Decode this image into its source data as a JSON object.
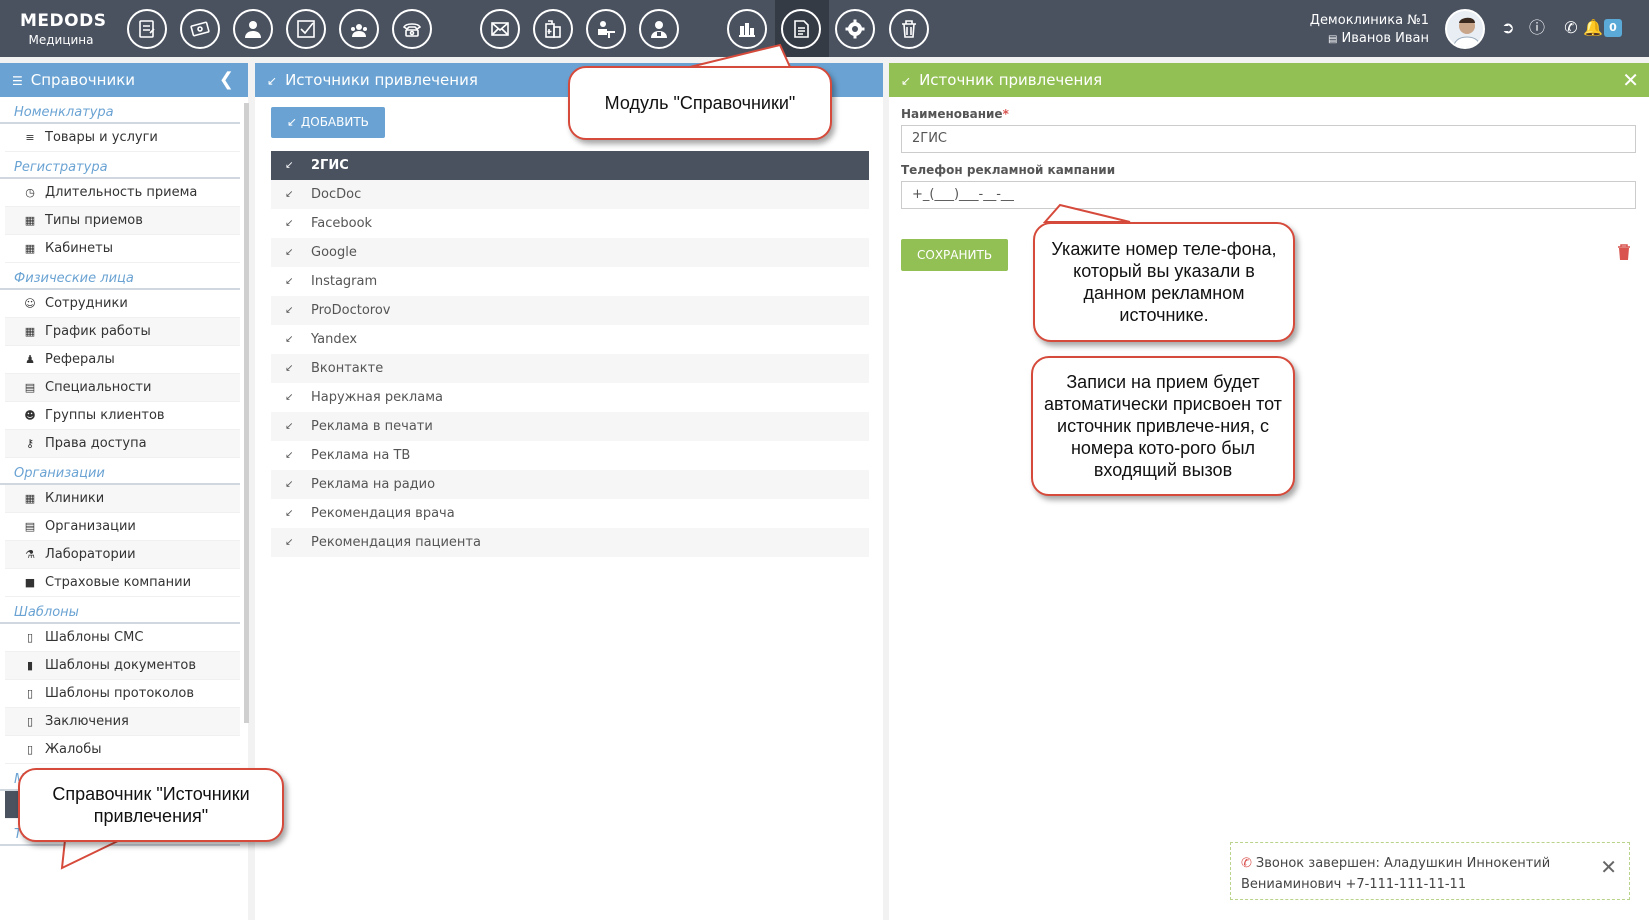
{
  "app": {
    "logo_line1": "MEDODS",
    "logo_line2": "Медицина",
    "clinic_name": "Демоклиника №1",
    "user_name": "Иванов Иван",
    "notification_count": "0"
  },
  "toolbar_icons": [
    "appointment-icon",
    "billing-icon",
    "client-icon",
    "tasks-icon",
    "call-center-icon",
    "telephony-icon",
    "mail-icon",
    "pharmacy-icon",
    "doctor-desk-icon",
    "doctor-icon",
    "reports-icon",
    "directories-icon",
    "settings-icon",
    "trash-icon"
  ],
  "sidebar": {
    "title": "Справочники",
    "groups": [
      {
        "label": "Номенклатура",
        "items": [
          "Товары и услуги"
        ]
      },
      {
        "label": "Регистратура",
        "items": [
          "Длительность приема",
          "Типы приемов",
          "Кабинеты"
        ]
      },
      {
        "label": "Физические лица",
        "items": [
          "Сотрудники",
          "График работы",
          "Рефералы",
          "Специальности",
          "Группы клиентов",
          "Права доступа"
        ]
      },
      {
        "label": "Организации",
        "items": [
          "Клиники",
          "Организации",
          "Лаборатории",
          "Страховые компании"
        ]
      },
      {
        "label": "Шаблоны",
        "items": [
          "Шаблоны СМС",
          "Шаблоны документов",
          "Шаблоны протоколов",
          "Заключения",
          "Жалобы"
        ]
      },
      {
        "label": "Маркетинг",
        "items": [
          "Источники привлечения"
        ]
      },
      {
        "label": "Телефония",
        "items": []
      }
    ],
    "selected": "Источники привлечения"
  },
  "middle": {
    "title": "Источники привлечения",
    "add_label": "ДОБАВИТЬ",
    "items": [
      "2ГИС",
      "DocDoc",
      "Facebook",
      "Google",
      "Instagram",
      "ProDoctorov",
      "Yandex",
      "Вконтакте",
      "Наружная реклама",
      "Реклама в печати",
      "Реклама на ТВ",
      "Реклама на радио",
      "Рекомендация врача",
      "Рекомендация пациента"
    ],
    "selected": "2ГИС"
  },
  "form": {
    "title": "Источник привлечения",
    "name_label": "Наименование",
    "name_required": "*",
    "name_value": "2ГИС",
    "phone_label": "Телефон рекламной кампании",
    "phone_value": "+_(___)___-__-__",
    "save_label": "СОХРАНИТЬ"
  },
  "toast": {
    "line1": "Звонок завершен: Аладушкин Иннокентий",
    "line2": "Вениаминович +7-111-111-11-11"
  },
  "callouts": {
    "module": "Модуль \"Справочники\"",
    "phone_hint": "Укажите номер теле-фона, который вы указали в данном рекламном источнике.",
    "auto_assign": "Записи на прием будет автоматически присвоен тот источник привлече-ния, с номера кото-рого был входящий вызов",
    "directory": "Справочник \"Источники привлечения\""
  }
}
